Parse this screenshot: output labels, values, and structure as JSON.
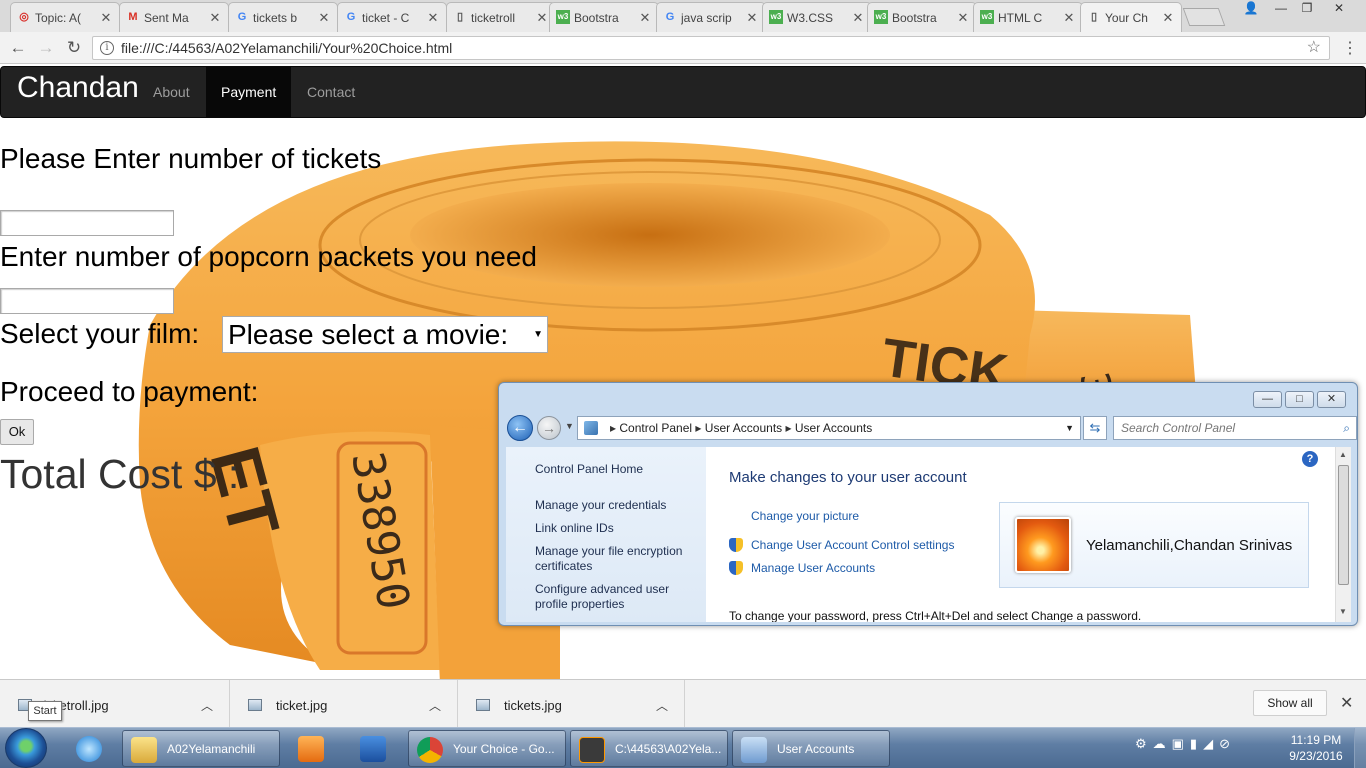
{
  "browser": {
    "tabs": [
      {
        "label": "Topic: A(",
        "icon": "forum-icon",
        "icon_glyph": "◎",
        "icon_color": "#d9302b"
      },
      {
        "label": "Sent Ma",
        "icon": "gmail-icon",
        "icon_glyph": "M",
        "icon_color": "#d93025"
      },
      {
        "label": "tickets b",
        "icon": "google-icon",
        "icon_glyph": "G",
        "icon_color": "#4285f4"
      },
      {
        "label": "ticket - C",
        "icon": "google-icon",
        "icon_glyph": "G",
        "icon_color": "#4285f4"
      },
      {
        "label": "ticketroll",
        "icon": "page-icon",
        "icon_glyph": "▯",
        "icon_color": "#555555"
      },
      {
        "label": "Bootstra",
        "icon": "w3schools-icon",
        "icon_glyph": "w3",
        "icon_color": "#4caf50"
      },
      {
        "label": "java scrip",
        "icon": "google-icon",
        "icon_glyph": "G",
        "icon_color": "#4285f4"
      },
      {
        "label": "W3.CSS",
        "icon": "w3schools-icon",
        "icon_glyph": "w3",
        "icon_color": "#4caf50"
      },
      {
        "label": "Bootstra",
        "icon": "w3schools-icon",
        "icon_glyph": "w3",
        "icon_color": "#4caf50"
      },
      {
        "label": "HTML C",
        "icon": "w3schools-icon",
        "icon_glyph": "w3",
        "icon_color": "#4caf50"
      },
      {
        "label": "Your Ch",
        "icon": "page-icon",
        "icon_glyph": "▯",
        "icon_color": "#555555"
      }
    ],
    "url": "file:///C:/44563/A02Yelamanchili/Your%20Choice.html"
  },
  "site": {
    "brand": "Chandan",
    "nav": [
      "About",
      "Payment",
      "Contact"
    ],
    "active_nav": "Payment"
  },
  "form": {
    "tickets_label": "Please Enter number of tickets",
    "tickets_value": "",
    "popcorn_label": "Enter number of popcorn packets you need",
    "popcorn_value": "",
    "film_label": "Select your film:",
    "film_selected": "Please select a movie:",
    "proceed_label": "Proceed to payment:",
    "ok_label": "Ok",
    "total_label": "Total Cost $ :"
  },
  "background_image": {
    "ticket_text": "TICKET",
    "serial": "338950",
    "digits": "33",
    "color": "#f4a43c"
  },
  "control_panel": {
    "breadcrumb": [
      "Control Panel",
      "User Accounts",
      "User Accounts"
    ],
    "search_placeholder": "Search Control Panel",
    "left_links": [
      "Control Panel Home",
      "Manage your credentials",
      "Link online IDs",
      "Manage your file encryption certificates",
      "Configure advanced user profile properties"
    ],
    "title": "Make changes to your user account",
    "links": [
      "Change your picture",
      "Change User Account Control settings",
      "Manage User Accounts"
    ],
    "user_name": "Yelamanchili,Chandan Srinivas",
    "footer_text": "To change your password, press Ctrl+Alt+Del and select Change a password."
  },
  "downloads": [
    {
      "name": "ticketroll.jpg"
    },
    {
      "name": "ticket.jpg"
    },
    {
      "name": "tickets.jpg"
    }
  ],
  "downloads_show_all": "Show all",
  "tooltip": "Start",
  "taskbar": {
    "items": [
      {
        "label": "A02Yelamanchili",
        "icon": "folder-icon"
      },
      {
        "label": "",
        "icon": "media-player-icon"
      },
      {
        "label": "",
        "icon": "visual-studio-icon"
      },
      {
        "label": "Your Choice - Go...",
        "icon": "chrome-icon"
      },
      {
        "label": "C:\\44563\\A02Yela...",
        "icon": "sublime-icon"
      },
      {
        "label": "User Accounts",
        "icon": "user-accounts-icon"
      }
    ],
    "clock_time": "11:19 PM",
    "clock_date": "9/23/2016"
  }
}
